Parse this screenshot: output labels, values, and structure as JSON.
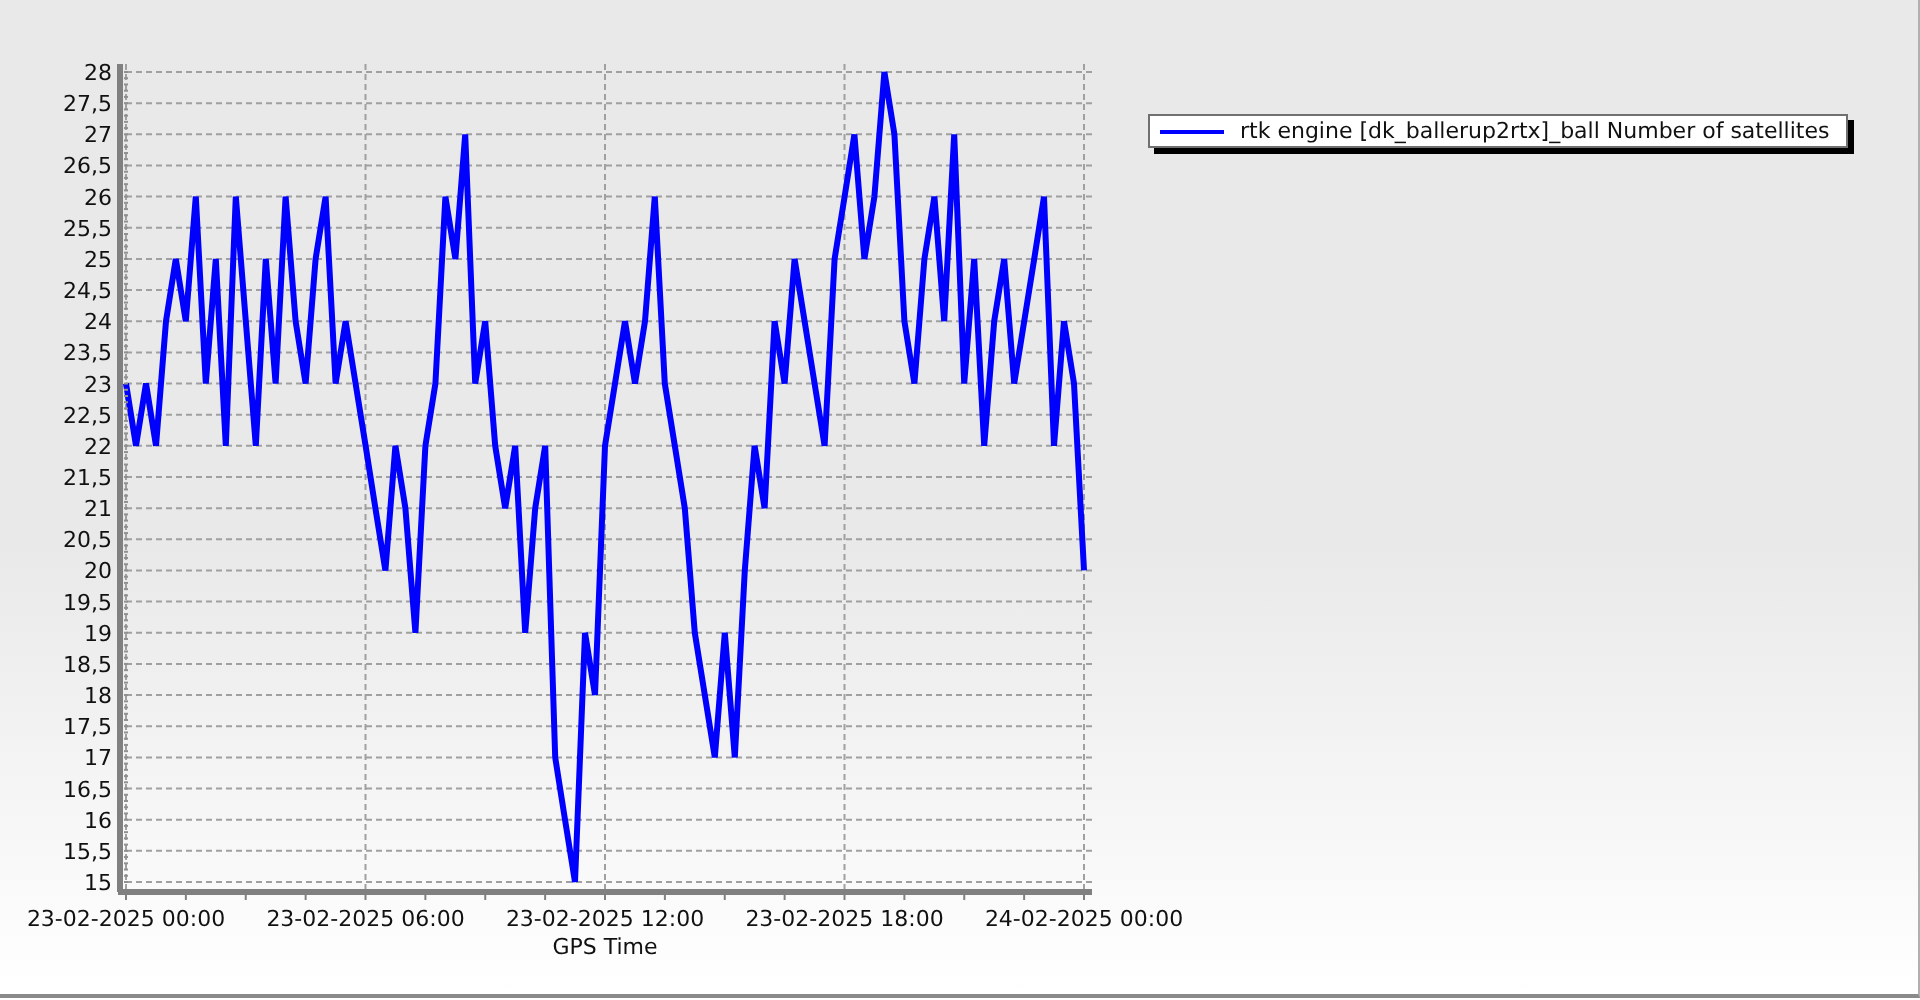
{
  "chart": {
    "chart_data": {
      "type": "line",
      "xlabel": "GPS Time",
      "categories": [
        "23-02-2025 00:00",
        null,
        null,
        null,
        null,
        null,
        null,
        null,
        null,
        null,
        null,
        null,
        null,
        null,
        null,
        null,
        null,
        null,
        null,
        null,
        null,
        null,
        null,
        null,
        "23-02-2025 06:00",
        null,
        null,
        null,
        null,
        null,
        null,
        null,
        null,
        null,
        null,
        null,
        null,
        null,
        null,
        null,
        null,
        null,
        null,
        null,
        null,
        null,
        null,
        null,
        "23-02-2025 12:00",
        null,
        null,
        null,
        null,
        null,
        null,
        null,
        null,
        null,
        null,
        null,
        null,
        null,
        null,
        null,
        null,
        null,
        null,
        null,
        null,
        null,
        null,
        null,
        "23-02-2025 18:00",
        null,
        null,
        null,
        null,
        null,
        null,
        null,
        null,
        null,
        null,
        null,
        null,
        null,
        null,
        null,
        null,
        null,
        null,
        null,
        null,
        null,
        null,
        null,
        "24-02-2025 00:00"
      ],
      "series": [
        {
          "name": "rtk engine [dk_ballerup2rtx]_ball Number of satellites",
          "color": "#0000ff",
          "values": [
            23,
            22,
            23,
            22,
            24,
            25,
            24,
            26,
            23,
            25,
            22,
            26,
            24,
            22,
            25,
            23,
            26,
            24,
            23,
            25,
            26,
            23,
            24,
            23,
            22,
            21,
            20,
            22,
            21,
            19,
            22,
            23,
            26,
            25,
            27,
            23,
            24,
            22,
            21,
            22,
            19,
            21,
            22,
            17,
            16,
            15,
            19,
            18,
            22,
            23,
            24,
            23,
            24,
            26,
            23,
            22,
            21,
            19,
            18,
            17,
            19,
            17,
            20,
            22,
            21,
            24,
            23,
            25,
            24,
            23,
            22,
            25,
            26,
            27,
            25,
            26,
            28,
            27,
            24,
            23,
            25,
            26,
            24,
            27,
            23,
            25,
            22,
            24,
            25,
            23,
            24,
            25,
            26,
            22,
            24,
            23,
            20
          ]
        }
      ],
      "grid": true,
      "ylim": [
        15,
        28
      ],
      "yticks": [
        {
          "value": 15,
          "label": "15"
        },
        {
          "value": 15.5,
          "label": "15,5"
        },
        {
          "value": 16,
          "label": "16"
        },
        {
          "value": 16.5,
          "label": "16,5"
        },
        {
          "value": 17,
          "label": "17"
        },
        {
          "value": 17.5,
          "label": "17,5"
        },
        {
          "value": 18,
          "label": "18"
        },
        {
          "value": 18.5,
          "label": "18,5"
        },
        {
          "value": 19,
          "label": "19"
        },
        {
          "value": 19.5,
          "label": "19,5"
        },
        {
          "value": 20,
          "label": "20"
        },
        {
          "value": 20.5,
          "label": "20,5"
        },
        {
          "value": 21,
          "label": "21"
        },
        {
          "value": 21.5,
          "label": "21,5"
        },
        {
          "value": 22,
          "label": "22"
        },
        {
          "value": 22.5,
          "label": "22,5"
        },
        {
          "value": 23,
          "label": "23"
        },
        {
          "value": 23.5,
          "label": "23,5"
        },
        {
          "value": 24,
          "label": "24"
        },
        {
          "value": 24.5,
          "label": "24,5"
        },
        {
          "value": 25,
          "label": "25"
        },
        {
          "value": 25.5,
          "label": "25,5"
        },
        {
          "value": 26,
          "label": "26"
        },
        {
          "value": 26.5,
          "label": "26,5"
        },
        {
          "value": 27,
          "label": "27"
        },
        {
          "value": 27.5,
          "label": "27,5"
        },
        {
          "value": 28,
          "label": "28"
        }
      ]
    }
  }
}
